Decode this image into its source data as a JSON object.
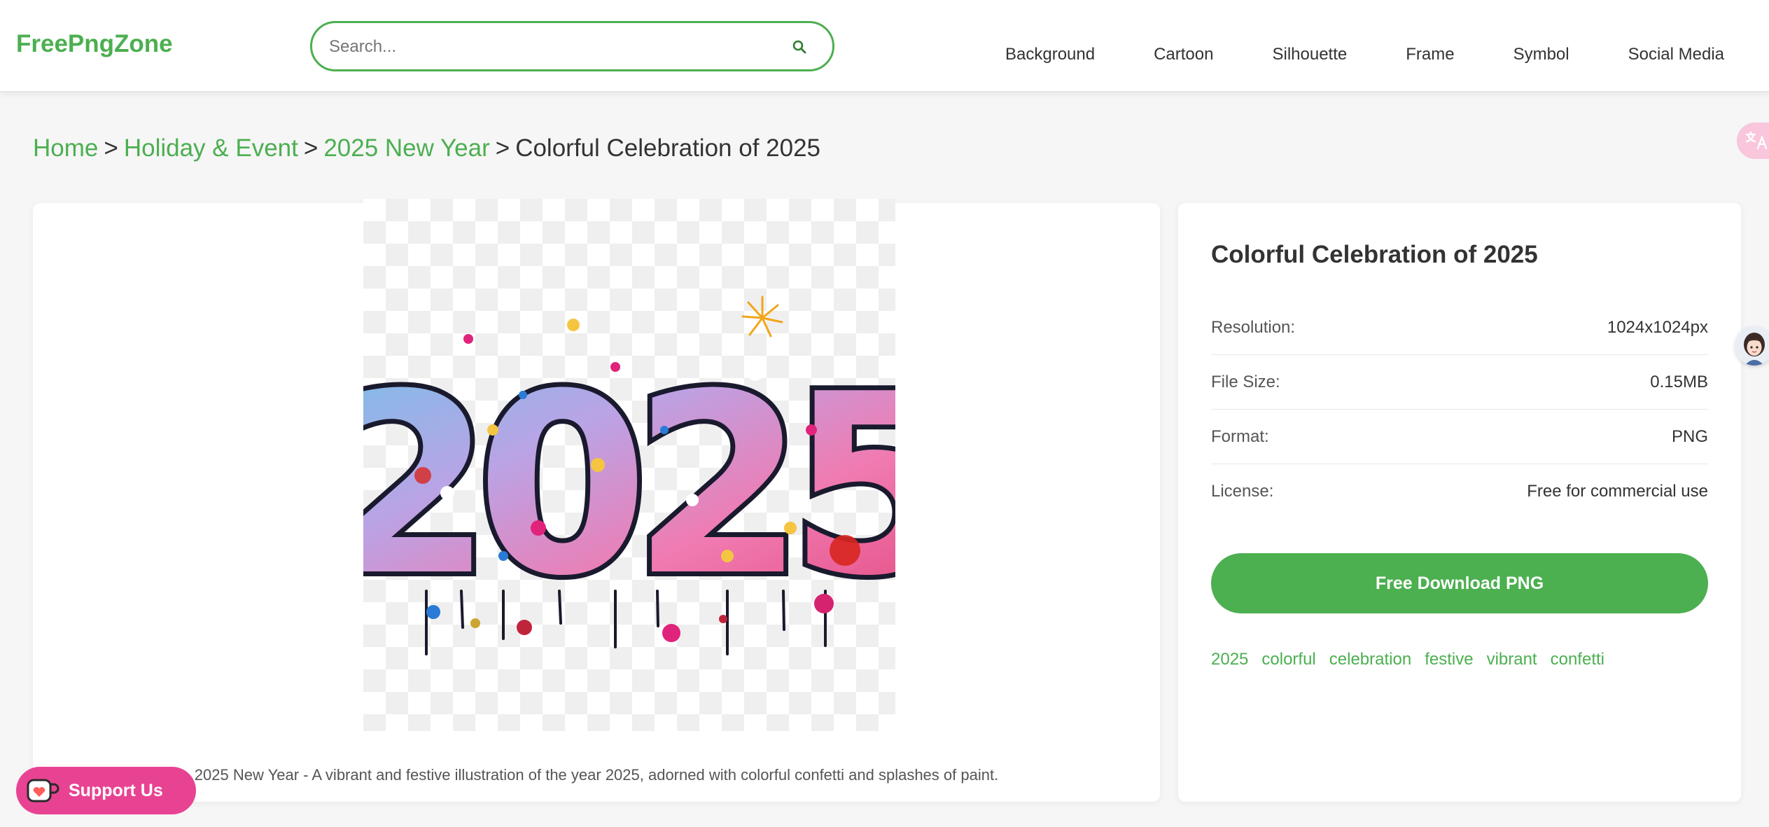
{
  "header": {
    "logo": "FreePngZone",
    "search": {
      "placeholder": "Search...",
      "value": ""
    },
    "nav": [
      "Background",
      "Cartoon",
      "Silhouette",
      "Frame",
      "Symbol",
      "Social Media"
    ]
  },
  "breadcrumb": {
    "items": [
      "Home",
      "Holiday & Event",
      "2025 New Year"
    ],
    "current": "Colorful Celebration of 2025",
    "separator": ">"
  },
  "image": {
    "depicted_text": "2025",
    "caption": "2025 New Year - A vibrant and festive illustration of the year 2025, adorned with colorful confetti and splashes of paint."
  },
  "info": {
    "title": "Colorful Celebration of 2025",
    "rows": [
      {
        "label": "Resolution:",
        "value": "1024x1024px"
      },
      {
        "label": "File Size:",
        "value": "0.15MB"
      },
      {
        "label": "Format:",
        "value": "PNG"
      },
      {
        "label": "License:",
        "value": "Free for commercial use"
      }
    ],
    "download_label": "Free Download PNG",
    "tags": [
      "2025",
      "colorful",
      "celebration",
      "festive",
      "vibrant",
      "confetti"
    ]
  },
  "support": {
    "label": "Support Us"
  },
  "colors": {
    "accent": "#4caf50",
    "support": "#e84393",
    "translate_widget": "#f9c6dc"
  },
  "icons": {
    "search": "search-icon",
    "support": "coffee-cup-icon",
    "translate": "translate-icon",
    "assistant": "avatar-icon"
  }
}
